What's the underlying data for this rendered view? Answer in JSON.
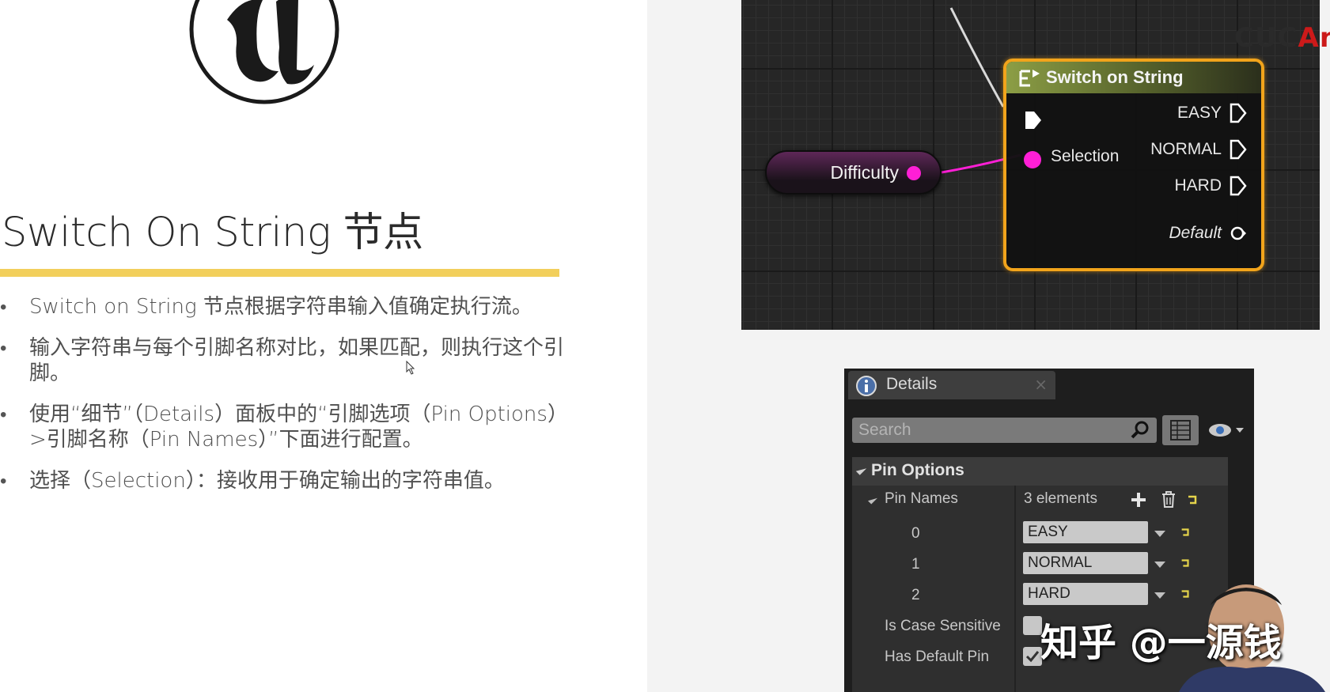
{
  "slide": {
    "title": "Switch On String 节点",
    "bullets": [
      "Switch on String 节点根据字符串输入值确定执行流。",
      "输入字符串与每个引脚名称对比，如果匹配，则执行这个引脚。",
      "使用“细节”（Details）面板中的“引脚选项（Pin Options）>引脚名称（Pin Names）”下面进行配置。",
      "选择（Selection）：接收用于确定输出的字符串值。"
    ]
  },
  "blueprint": {
    "variable_node": {
      "label": "Difficulty",
      "pin_color": "#ff1fd6"
    },
    "switch_node": {
      "title": "Switch on String",
      "input_label": "Selection",
      "outputs": [
        "EASY",
        "NORMAL",
        "HARD"
      ],
      "default_label": "Default",
      "border_color": "#f2a41b"
    },
    "watermark": {
      "text_main": "CUC",
      "text_red": "An"
    }
  },
  "details": {
    "tab_title": "Details",
    "tab_close": "×",
    "search_placeholder": "Search",
    "category": "Pin Options",
    "pin_names_label": "Pin Names",
    "elements_text": "3 elements",
    "rows": [
      {
        "index": "0",
        "value": "EASY"
      },
      {
        "index": "1",
        "value": "NORMAL"
      },
      {
        "index": "2",
        "value": "HARD"
      }
    ],
    "case_sensitive_label": "Is Case Sensitive",
    "case_sensitive_checked": false,
    "has_default_label": "Has Default Pin",
    "has_default_checked": true
  },
  "overlay": {
    "watermark": "知乎 @一源钱"
  }
}
